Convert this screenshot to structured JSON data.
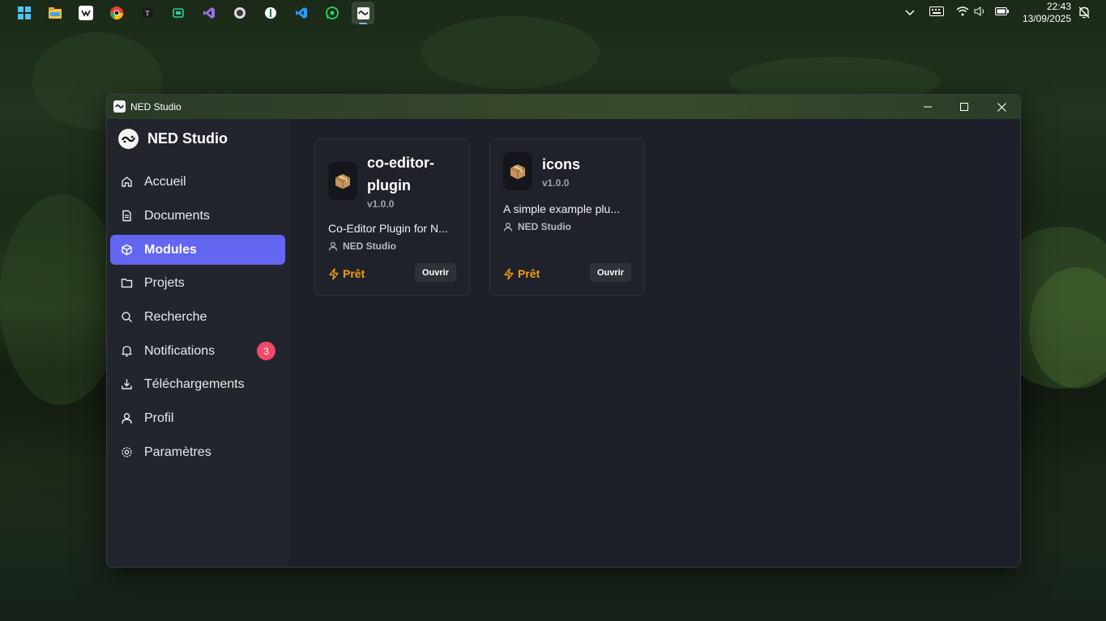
{
  "taskbar": {
    "icons": [
      "windows-start-icon",
      "file-explorer-icon",
      "app-icon-1",
      "chrome-icon",
      "app-icon-2",
      "app-icon-3",
      "visual-studio-icon",
      "obs-icon",
      "app-icon-4",
      "vscode-icon",
      "whatsapp-icon",
      "ned-studio-icon"
    ],
    "clock_time": "22:43",
    "clock_date": "13/09/2025"
  },
  "window": {
    "title": "NED Studio"
  },
  "sidebar": {
    "brand": "NED Studio",
    "items": [
      {
        "label": "Accueil",
        "icon": "home-icon"
      },
      {
        "label": "Documents",
        "icon": "document-icon"
      },
      {
        "label": "Modules",
        "icon": "box-icon",
        "active": true
      },
      {
        "label": "Projets",
        "icon": "folder-icon"
      },
      {
        "label": "Recherche",
        "icon": "search-icon"
      },
      {
        "label": "Notifications",
        "icon": "bell-icon",
        "badge": "3"
      },
      {
        "label": "Téléchargements",
        "icon": "download-icon"
      },
      {
        "label": "Profil",
        "icon": "user-icon"
      },
      {
        "label": "Paramètres",
        "icon": "settings-icon"
      }
    ]
  },
  "modules": [
    {
      "name_line1": "co-editor-",
      "name_line2": "plugin",
      "version": "v1.0.0",
      "description": "Co-Editor Plugin for N...",
      "author": "NED Studio",
      "status": "Prêt",
      "button": "Ouvrir"
    },
    {
      "name_line1": "icons",
      "version": "v1.0.0",
      "description": "A simple example plu...",
      "author": "NED Studio",
      "status": "Prêt",
      "button": "Ouvrir"
    }
  ],
  "colors": {
    "accent": "#6366f1",
    "status": "#f59e0b",
    "badge": "#f0496c"
  }
}
